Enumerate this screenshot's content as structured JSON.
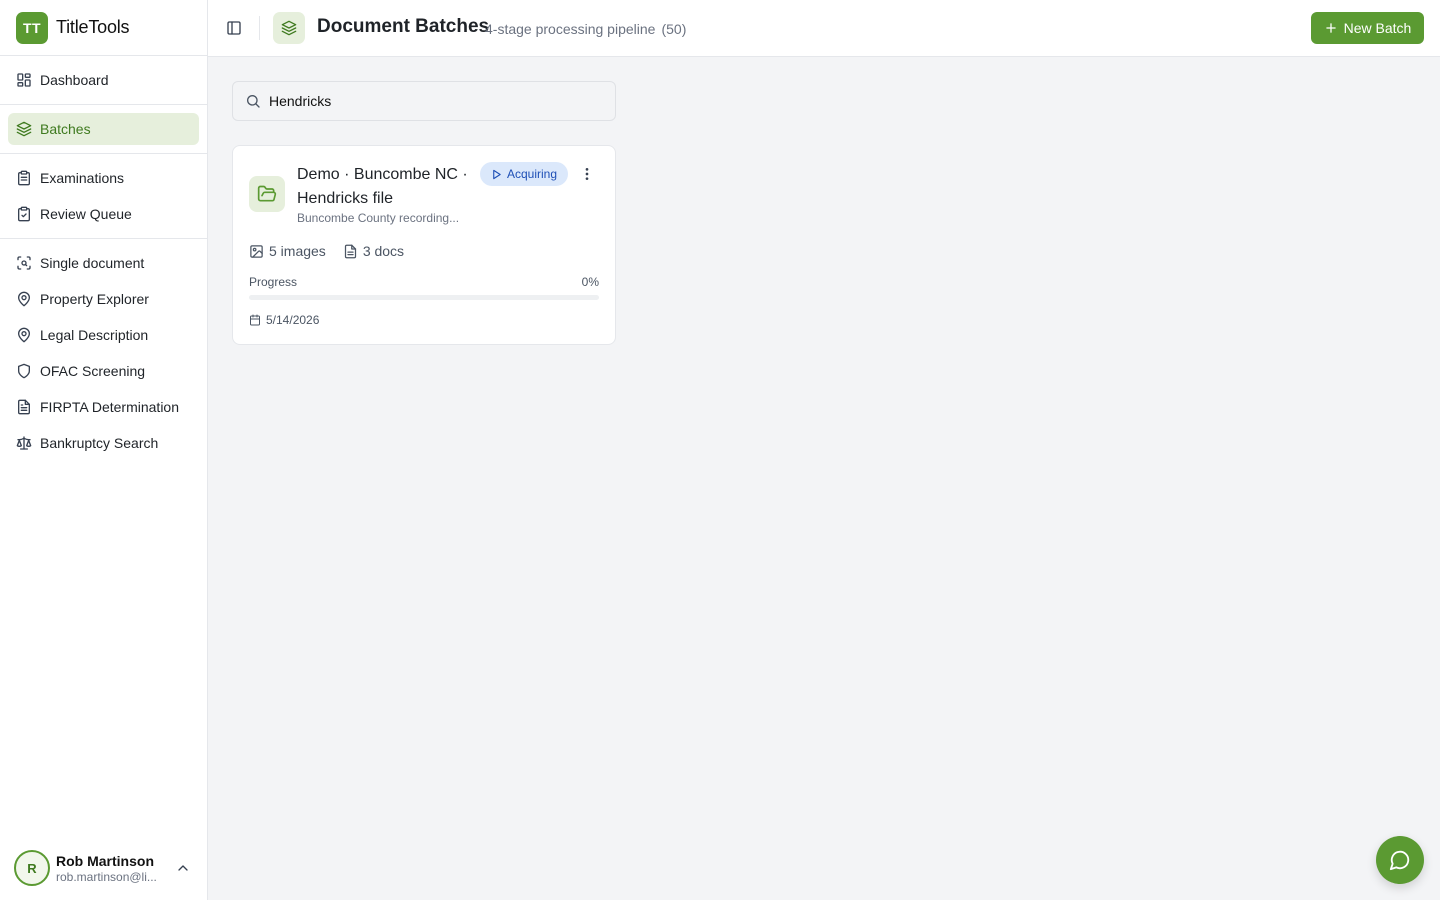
{
  "brand": {
    "logo_text": "TT",
    "name": "TitleTools"
  },
  "sidebar": {
    "groups": [
      {
        "items": [
          {
            "label": "Dashboard",
            "icon": "dashboard-icon",
            "active": false
          }
        ]
      },
      {
        "items": [
          {
            "label": "Batches",
            "icon": "layers-icon",
            "active": true
          }
        ]
      },
      {
        "items": [
          {
            "label": "Examinations",
            "icon": "clipboard-check-icon",
            "active": false
          },
          {
            "label": "Review Queue",
            "icon": "clipboard-list-icon",
            "active": false
          }
        ]
      },
      {
        "items": [
          {
            "label": "Single document",
            "icon": "scan-icon",
            "active": false
          },
          {
            "label": "Property Explorer",
            "icon": "map-pin-icon",
            "active": false
          },
          {
            "label": "Legal Description",
            "icon": "map-pin-icon",
            "active": false
          },
          {
            "label": "OFAC Screening",
            "icon": "shield-icon",
            "active": false
          },
          {
            "label": "FIRPTA Determination",
            "icon": "file-text-icon",
            "active": false
          },
          {
            "label": "Bankruptcy Search",
            "icon": "scale-icon",
            "active": false
          }
        ]
      }
    ]
  },
  "user": {
    "initial": "R",
    "name": "Rob Martinson",
    "email": "rob.martinson@li..."
  },
  "header": {
    "title": "Document Batches",
    "subtitle": "4-stage processing pipeline",
    "count": "(50)",
    "new_batch_label": "New Batch"
  },
  "search": {
    "value": "Hendricks",
    "placeholder": ""
  },
  "batches": [
    {
      "title": "Demo · Buncombe NC · Hendricks file",
      "description": "Buncombe County recording...",
      "status": "Acquiring",
      "images": "5 images",
      "docs": "3 docs",
      "progress_label": "Progress",
      "progress_text": "0%",
      "progress_fraction": 0,
      "date": "5/14/2026"
    }
  ],
  "colors": {
    "accent": "#5b9a32",
    "accent_soft": "#e6efdc",
    "status_badge_bg": "#dbe8fb",
    "status_badge_text": "#1e4fb6"
  }
}
